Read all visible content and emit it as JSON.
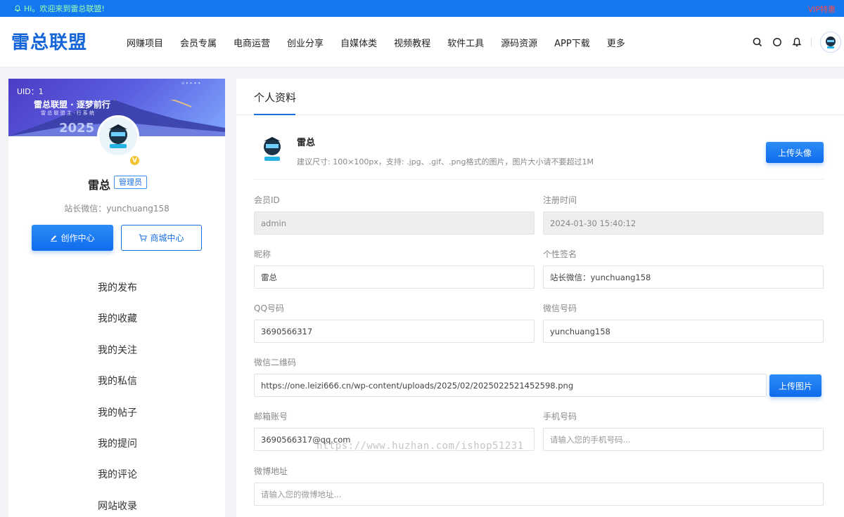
{
  "notice": {
    "text": "Hi。欢迎来到雷总联盟!",
    "vip": "VIP特惠"
  },
  "header": {
    "logo": "雷总联盟",
    "nav": [
      "网赚项目",
      "会员专属",
      "电商运营",
      "创业分享",
      "自媒体类",
      "视频教程",
      "软件工具",
      "源码资源",
      "APP下载",
      "更多"
    ]
  },
  "sidebar": {
    "uid": "UID：1",
    "banner_title": "雷总联盟 · 逐梦前行",
    "banner_sub": "雷 总 联 盟 主 · 行 系 统",
    "banner_year": "2025",
    "name": "雷总",
    "role": "管理员",
    "verified": "V",
    "desc": "站长微信：yunchuang158",
    "create_btn": "创作中心",
    "shop_btn": "商城中心",
    "menu": [
      "我的发布",
      "我的收藏",
      "我的关注",
      "我的私信",
      "我的帖子",
      "我的提问",
      "我的评论",
      "网站收录"
    ]
  },
  "profile": {
    "tab": "个人资料",
    "name": "雷总",
    "hint": "建议尺寸: 100×100px，支持: .jpg、.gif、.png格式的图片，图片大小请不要超过1M",
    "upload_avatar": "上传头像",
    "fields": {
      "member_id": {
        "label": "会员ID",
        "value": "admin"
      },
      "reg_time": {
        "label": "注册时间",
        "value": "2024-01-30 15:40:12"
      },
      "nickname": {
        "label": "昵称",
        "value": "雷总"
      },
      "signature": {
        "label": "个性签名",
        "value": "站长微信：yunchuang158"
      },
      "qq": {
        "label": "QQ号码",
        "value": "3690566317"
      },
      "wechat": {
        "label": "微信号码",
        "value": "yunchuang158"
      },
      "wechat_qr": {
        "label": "微信二维码",
        "value": "https://one.leizi666.cn/wp-content/uploads/2025/02/2025022521452598.png"
      },
      "email": {
        "label": "邮箱账号",
        "value": "3690566317@qq.com"
      },
      "phone": {
        "label": "手机号码",
        "placeholder": "请输入您的手机号码..."
      },
      "weibo": {
        "label": "微博地址",
        "placeholder": "请输入您的微博地址..."
      }
    },
    "upload_img": "上传图片"
  },
  "watermark": "https://www.huzhan.com/ishop51231",
  "colors": {
    "primary": "#1478f0",
    "accent": "#1a6fe0"
  }
}
